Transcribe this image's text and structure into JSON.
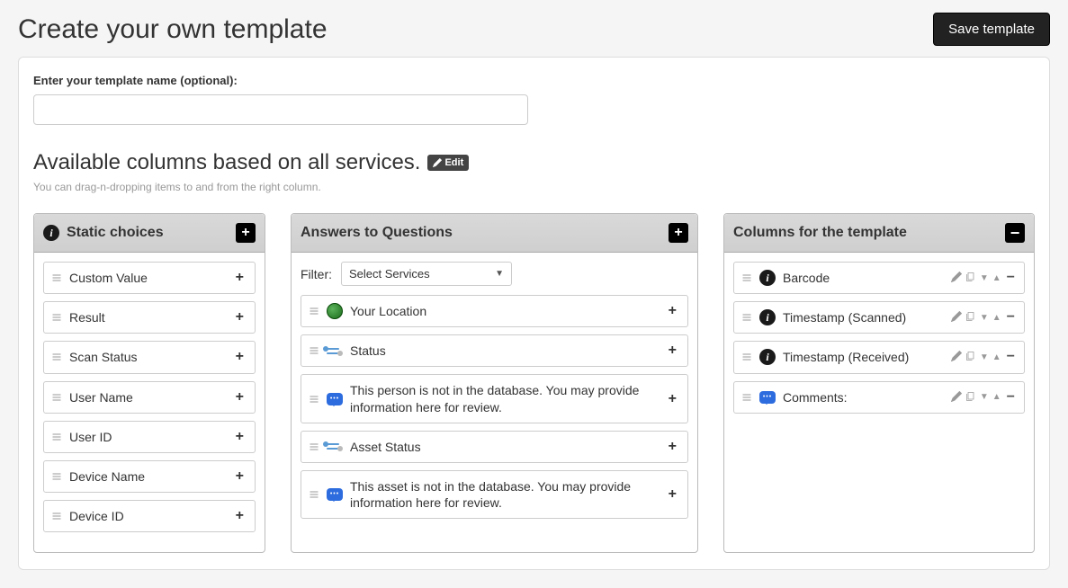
{
  "header": {
    "title": "Create your own template",
    "save_label": "Save template"
  },
  "template_name": {
    "label": "Enter your template name (optional):",
    "value": ""
  },
  "columns_section": {
    "heading": "Available columns based on all services.",
    "edit_label": "Edit",
    "helper": "You can drag-n-dropping items to and from the right column."
  },
  "static_choices": {
    "title": "Static choices",
    "items": [
      {
        "label": "Custom Value"
      },
      {
        "label": "Result"
      },
      {
        "label": "Scan Status"
      },
      {
        "label": "User Name"
      },
      {
        "label": "User ID"
      },
      {
        "label": "Device Name"
      },
      {
        "label": "Device ID"
      }
    ]
  },
  "answers": {
    "title": "Answers to Questions",
    "filter_label": "Filter:",
    "filter_select": "Select Services",
    "items": [
      {
        "icon": "globe",
        "label": "Your Location"
      },
      {
        "icon": "toggle",
        "label": "Status"
      },
      {
        "icon": "chat",
        "label": "This person is not in the database. You may provide information here for review."
      },
      {
        "icon": "toggle",
        "label": "Asset Status"
      },
      {
        "icon": "chat",
        "label": "This asset is not in the database. You may provide information here for review."
      }
    ]
  },
  "template_columns": {
    "title": "Columns for the template",
    "items": [
      {
        "icon": "info",
        "label": "Barcode"
      },
      {
        "icon": "info",
        "label": "Timestamp (Scanned)"
      },
      {
        "icon": "info",
        "label": "Timestamp (Received)"
      },
      {
        "icon": "chat",
        "label": "Comments:"
      }
    ]
  }
}
